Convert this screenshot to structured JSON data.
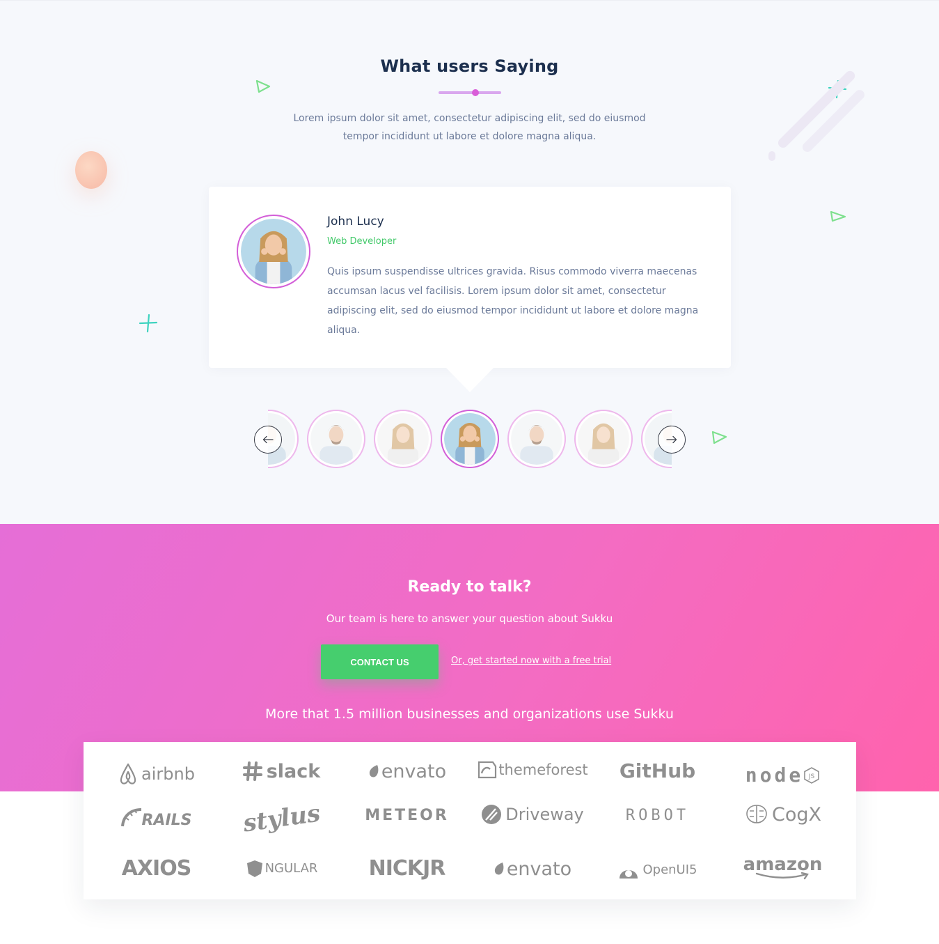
{
  "testimonials": {
    "title": "What users Saying",
    "description_lines": [
      "Lorem ipsum dolor sit amet, consectetur adipiscing elit, sed do eiusmod",
      "tempor incididunt ut labore et dolore magna aliqua."
    ],
    "active": {
      "name": "John Lucy",
      "role": "Web Developer",
      "quote": "Quis ipsum suspendisse ultrices gravida. Risus commodo viverra maecenas accumsan lacus vel facilisis. Lorem ipsum dolor sit amet, consectetur adipiscing elit, sed do eiusmod tempor incididunt ut labore et dolore magna aliqua."
    }
  },
  "cta": {
    "title": "Ready to talk?",
    "subtitle": "Our team is here to answer your question about Sukku",
    "contact_button": "CONTACT US",
    "trial_link": "Or, get started now with a free trial",
    "stat": "More that 1.5 million businesses and organizations use Sukku"
  },
  "logos": [
    "airbnb",
    "slack",
    "envato",
    "themeforest",
    "GitHub",
    "node",
    "RAILS",
    "stylus",
    "METEOR",
    "Driveway",
    "ROBOT",
    "CogX",
    "AXIOS",
    "NGULAR",
    "NICKJR",
    "envato",
    "OpenUI5",
    "amazon"
  ],
  "colors": {
    "accent_pink": "#d35fd8",
    "accent_green": "#43c96a",
    "cta_gradient_start": "#e56ed7",
    "cta_gradient_end": "#ff63ad",
    "title_navy": "#1c2f4e"
  }
}
